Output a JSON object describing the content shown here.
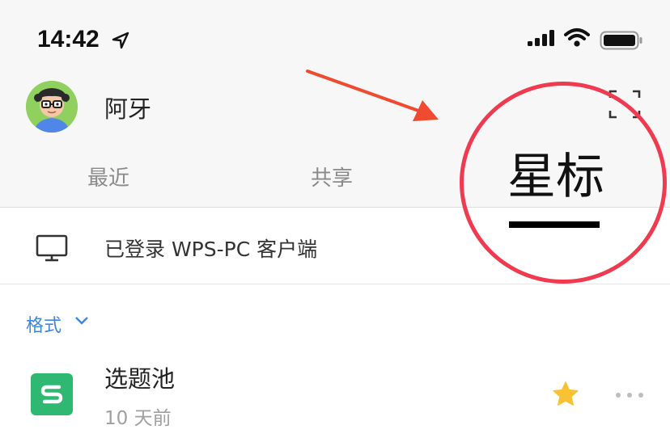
{
  "status_bar": {
    "time": "14:42"
  },
  "user": {
    "name": "阿牙"
  },
  "tabs": [
    {
      "label": "最近",
      "active": false
    },
    {
      "label": "共享",
      "active": false
    },
    {
      "label": "星标",
      "active": true
    }
  ],
  "pc_login": {
    "text": "已登录 WPS-PC 客户端"
  },
  "filter": {
    "label": "格式"
  },
  "files": [
    {
      "name": "选题池",
      "time": "10 天前",
      "starred": true
    }
  ],
  "colors": {
    "accent": "#3f86e0",
    "annotation": "#f03a50",
    "file_sheet": "#2eb872",
    "star": "#f8c233"
  }
}
